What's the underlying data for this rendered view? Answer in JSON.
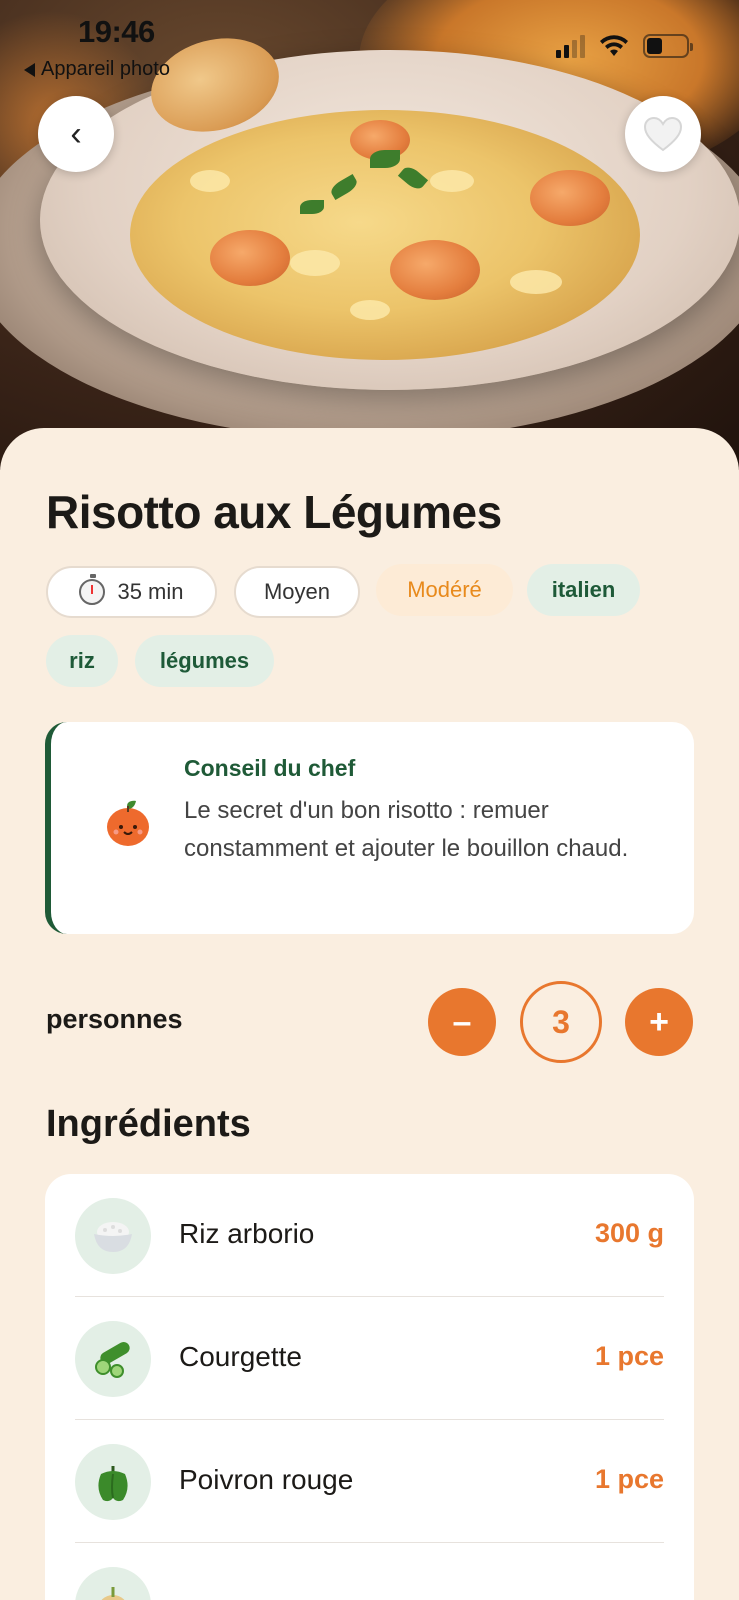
{
  "status_bar": {
    "time": "19:46",
    "back_app": "Appareil photo"
  },
  "hero": {
    "back_label": "‹",
    "favorite_icon": "heart-icon"
  },
  "recipe": {
    "title": "Risotto aux Légumes",
    "tags": [
      {
        "label": "35 min",
        "icon": "timer-icon",
        "style": "white"
      },
      {
        "label": "Moyen",
        "style": "white"
      },
      {
        "label": "Modéré",
        "style": "orange"
      },
      {
        "label": "italien",
        "style": "green"
      },
      {
        "label": "riz",
        "style": "green"
      },
      {
        "label": "légumes",
        "style": "green"
      }
    ]
  },
  "tip": {
    "icon": "orange-mascot-icon",
    "title": "Conseil du chef",
    "text": "Le secret d'un bon risotto : remuer constamment et ajouter le bouillon chaud."
  },
  "servings": {
    "label": "personnes",
    "minus": "–",
    "count": "3",
    "plus": "+"
  },
  "ingredients": {
    "title": "Ingrédients",
    "items": [
      {
        "name": "Riz arborio",
        "qty": "300 g",
        "icon": "rice-bowl-icon"
      },
      {
        "name": "Courgette",
        "qty": "1 pce",
        "icon": "cucumber-icon"
      },
      {
        "name": "Poivron rouge",
        "qty": "1 pce",
        "icon": "bell-pepper-icon"
      },
      {
        "name": "",
        "qty": "",
        "icon": "onion-icon"
      }
    ]
  },
  "colors": {
    "accent": "#e8772e",
    "green": "#1f5a37",
    "background": "#faeee0"
  }
}
